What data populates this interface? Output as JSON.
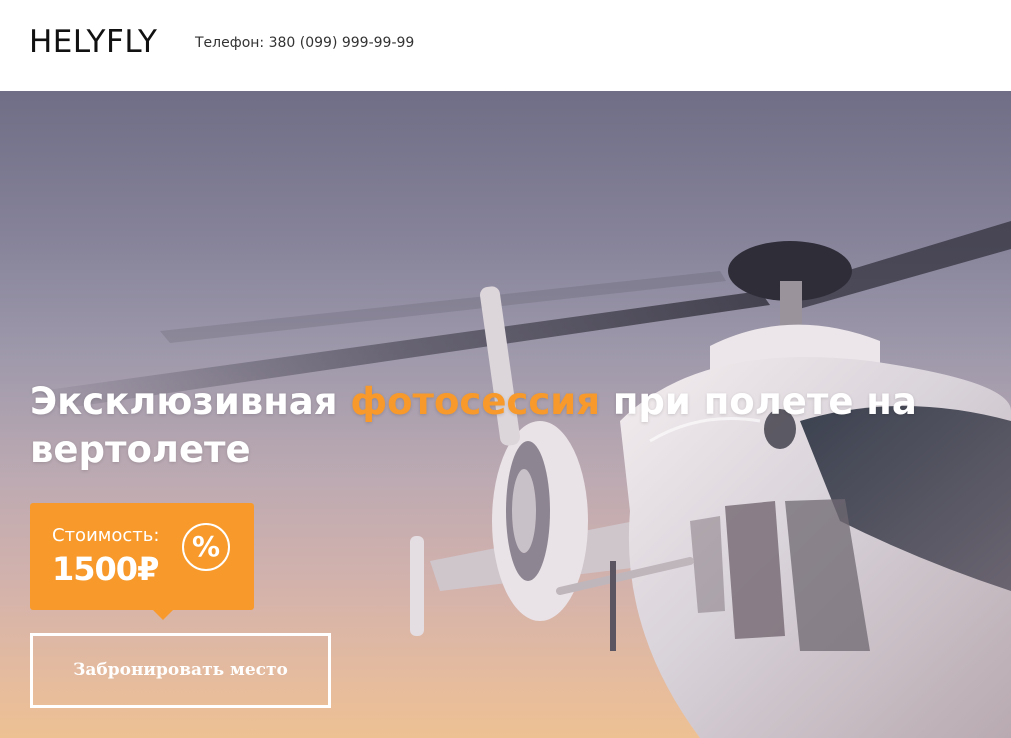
{
  "header": {
    "logo": "HELYFLY",
    "phone": "Телефон: 380 (099) 999-99-99"
  },
  "hero": {
    "title_start": "Эксклюзивная ",
    "title_accent": "фотосессия",
    "title_end": " при полете на вертолете",
    "price_label": "Стоимость:",
    "price_value": "1500₽",
    "discount_symbol": "%",
    "book_button_label": "Забронировать место",
    "accent_color": "#f79a2b"
  }
}
